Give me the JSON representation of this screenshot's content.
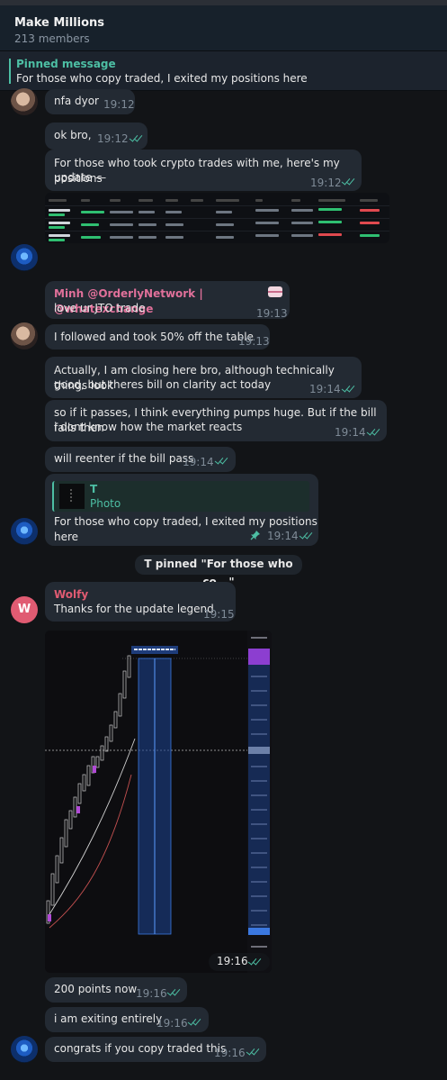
{
  "header": {
    "title": "Make Millions",
    "members": "213 members"
  },
  "pinned": {
    "label": "Pinned message",
    "text": "For those who copy traded, I exited my positions here"
  },
  "messages": [
    {
      "text": "nfa dyor",
      "time": "19:12"
    },
    {
      "text": "ok bro,",
      "time": "19:12"
    },
    {
      "line1": "For those who took crypto trades with me, here's my positions",
      "line2": "update —",
      "time": "19:12"
    },
    {
      "sender": "Minh @OrderlyNetwork | @whatexchange",
      "text": "love ur JTO trade",
      "time": "19:13"
    },
    {
      "text": "I followed and took 50% off the table",
      "time": "19:13"
    },
    {
      "line1": "Actually, I am closing here bro, although technically things look",
      "line2": "good, but theres bill on clarity act today",
      "time": "19:14"
    },
    {
      "line1": "so if it passes, I think everything pumps huge. But if the bill fails then",
      "line2": "i dont know how the market reacts",
      "time": "19:14"
    },
    {
      "text": "will reenter if the bill pass",
      "time": "19:14"
    },
    {
      "reply_name": "T",
      "reply_type": "Photo",
      "text": "For those who copy traded, I exited my positions here",
      "time": "19:14"
    },
    {
      "system": "T pinned \"For those who co...\""
    },
    {
      "sender": "Wolfy",
      "avatar_letter": "W",
      "text": "Thanks for the update legend",
      "time": "19:15"
    },
    {
      "image_time": "19:16"
    },
    {
      "text": "200 points now",
      "time": "19:16"
    },
    {
      "text": "i am exiting entirely",
      "time": "19:16"
    },
    {
      "text": "congrats if you copy traded this",
      "time": "19:16"
    }
  ],
  "colors": {
    "accent": "#4dbfa4",
    "minh": "#e0709a",
    "wolfy": "#e05b72",
    "bubble": "#232a33"
  }
}
